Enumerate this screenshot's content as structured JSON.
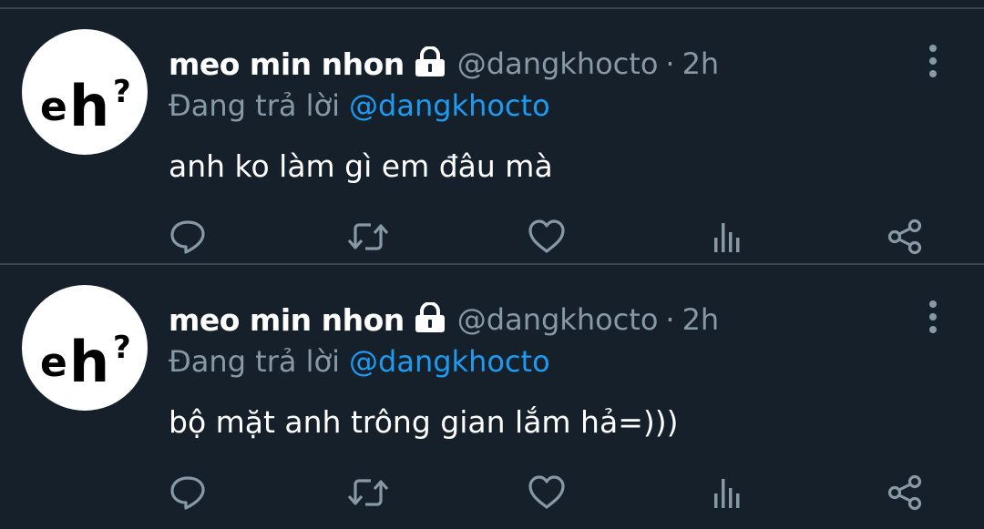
{
  "tweets": [
    {
      "display_name": "meo min nhon",
      "handle": "@dangkhocto",
      "separator": "·",
      "time": "2h",
      "reply_prefix": "Đang trả lời",
      "reply_mention": "@dangkhocto",
      "text": "anh ko làm gì em đâu mà",
      "avatar_text": "eh?",
      "icons": [
        "lock-icon",
        "more-vertical-icon",
        "reply-icon",
        "retweet-icon",
        "like-icon",
        "stats-icon",
        "share-icon"
      ]
    },
    {
      "display_name": "meo min nhon",
      "handle": "@dangkhocto",
      "separator": "·",
      "time": "2h",
      "reply_prefix": "Đang trả lời",
      "reply_mention": "@dangkhocto",
      "text": "bộ mặt anh trông gian lắm hả=)))",
      "avatar_text": "eh?",
      "icons": [
        "lock-icon",
        "more-vertical-icon",
        "reply-icon",
        "retweet-icon",
        "like-icon",
        "stats-icon",
        "share-icon"
      ]
    }
  ],
  "colors": {
    "background": "#15202b",
    "divider": "#38444d",
    "secondary_text": "#8899a6",
    "mention": "#1d9bf0",
    "primary_text": "#ffffff"
  }
}
